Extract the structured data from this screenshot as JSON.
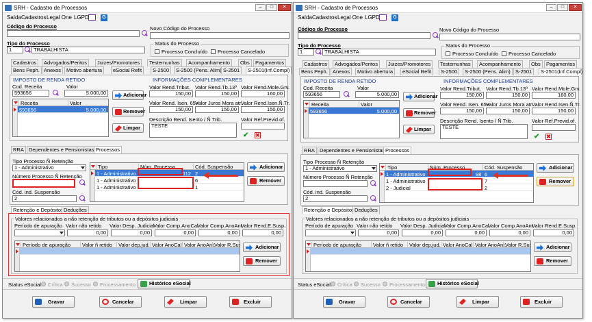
{
  "window": {
    "title": "SRH - Cadastro de Processos",
    "icon": "app-icon",
    "controls": {
      "min": "–",
      "max": "□",
      "close": "✕"
    }
  },
  "menu": {
    "saida": "Saída",
    "cadastros": "Cadastros",
    "legal_one": "Legal One",
    "lgpd": "LGPD"
  },
  "fields": {
    "codigo_label": "Código do Processo",
    "novo_codigo_label": "Novo Código do Processo",
    "tipo_label": "Tipo do Processo",
    "tipo_code": "1",
    "tipo_value": "TRABALHISTA",
    "status_group": "Status do Processo",
    "concluido": "Processo Concluído",
    "cancelado": "Processo Cancelado"
  },
  "tabs_row1": [
    "Cadastros",
    "Advogados/Peritos",
    "Juizes/Promotores",
    "Testemunhas",
    "Acompanhamento",
    "Obs",
    "Pagamentos"
  ],
  "tabs_row2": [
    "Bens Peph.",
    "Anexos",
    "Motivo abertura",
    "eSocial Refit",
    "S-2500",
    "S-2500 (Pens. Alim)",
    "S-2501",
    "S-2501(Inf.Compl)"
  ],
  "ir": {
    "group": "IMPOSTO DE RENDA RETIDO",
    "cod_receita_label": "Cod. Receita",
    "valor_label": "Valor",
    "cod_receita": "593656",
    "valor": "5.000,00",
    "grid_cols": [
      "Receita",
      "Valor"
    ],
    "grid_rows": [
      [
        "593656",
        "5.000,00"
      ]
    ],
    "btn_add": "Adicionar",
    "btn_del": "Remover",
    "btn_clear": "Limpar"
  },
  "info": {
    "group": "INFORMAÇÕES COMPLEMENTARES",
    "labels": [
      "Valor Rend.Tribut.",
      "Valor Rend.Tb.13º",
      "Valor Rend.Mole.Grv.",
      "Valor Rend. Isen. 65+",
      "Valor Juros Mora atr.",
      "Valor Rend.Isen.Ñ.Tr."
    ],
    "values": [
      "150,00",
      "150,00",
      "160,00",
      "150,00",
      "150,00",
      "150,00"
    ],
    "desc_label": "Descrição Rend. Isento / Ñ Trib.",
    "desc_value": "TESTE",
    "prev_label": "Valor Ref.Previd.of.",
    "prev_value": "",
    "ok": "✔",
    "cancel": "✖"
  },
  "subtabs": [
    "RRA",
    "Dependentes e Pensionistas",
    "Processos"
  ],
  "proc": {
    "tipo_label": "Tipo Processo Ñ Retenção",
    "tipo_value": "1 - Administrativo",
    "numero_label": "Número Processo Ñ Retenção",
    "numero_value": "",
    "cod_susp_label": "Cód. ind. Suspensão",
    "cod_susp_value": "2",
    "grid_cols": [
      "Tipo",
      "Núm. Processo",
      "Cód. Suspensão"
    ],
    "rows_left": [
      [
        "1 - Administrativo",
        "112",
        "2"
      ],
      [
        "1 - Administrativo",
        "",
        "6"
      ],
      [
        "1 - Administrativo",
        "",
        "1"
      ]
    ],
    "rows_right": [
      [
        "1 - Administrativo",
        "98",
        "6"
      ],
      [
        "1 - Administrativo",
        "",
        "7"
      ],
      [
        "2 - Judicial",
        "",
        "2"
      ]
    ],
    "btn_add": "Adicionar",
    "btn_del": "Remover"
  },
  "ret_tabs": [
    "Retenção e Depósitos",
    "Deduções"
  ],
  "ret": {
    "group": "Valores relacionados a não retenção de tributos ou a depósitos judiciais",
    "cols": [
      "Período de apuração",
      "Valor não retido",
      "Valor Desp. Judicial",
      "Valor Comp.AnoCal.",
      "Valor Comp.AnoAnt.",
      "Valor Rend.E.Susp."
    ],
    "values": [
      "",
      "0,00",
      "0,00",
      "0,00",
      "0,00",
      "0,00"
    ],
    "grid_cols": [
      "Período de apuração",
      "Valor ñ retido",
      "Valor dep.jud.",
      "Valor AnoCal.",
      "Valor AnoAnt.",
      "Valor R.Susp."
    ],
    "btn_add": "Adicionar",
    "btn_del": "Remover"
  },
  "status": {
    "label": "Status eSocial:",
    "critica": "Crítica",
    "sucesso": "Sucesso",
    "processamento": "Processamento",
    "historico": "Histórico eSocial"
  },
  "footer": {
    "gravar": "Gravar",
    "cancelar": "Cancelar",
    "limpar": "Limpar",
    "excluir": "Excluir"
  }
}
